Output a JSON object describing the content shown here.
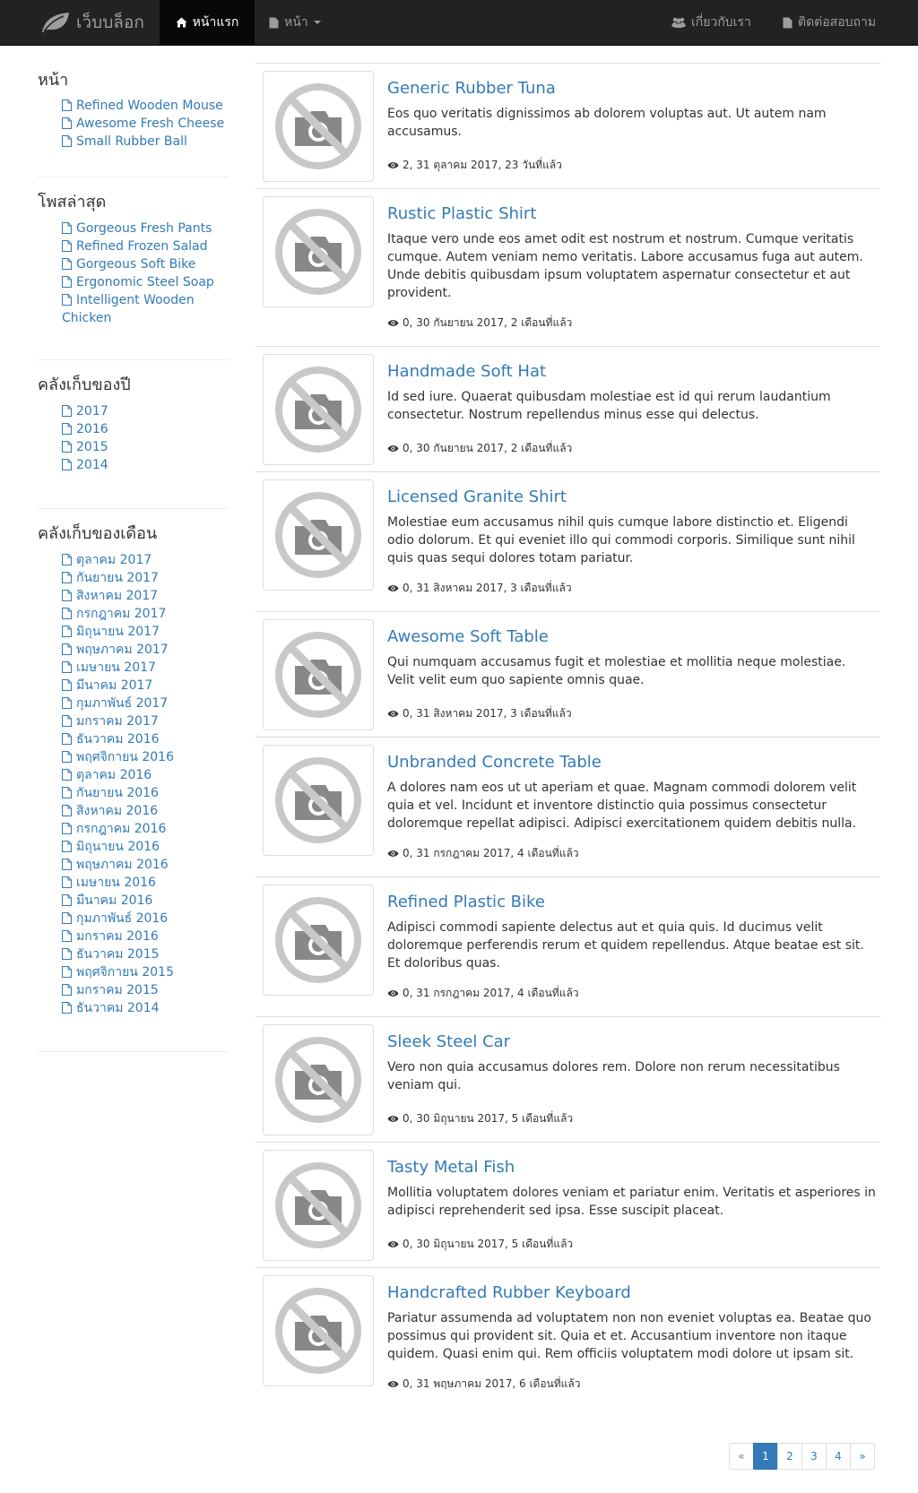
{
  "navbar": {
    "brand": "เว็บบล็อก",
    "home_label": "หน้าแรก",
    "pages_label": "หน้า",
    "about_label": "เกี่ยวกับเรา",
    "contact_label": "ติดต่อสอบถาม"
  },
  "sidebar": {
    "pages": {
      "title": "หน้า",
      "items": [
        "Refined Wooden Mouse",
        "Awesome Fresh Cheese",
        "Small Rubber Ball"
      ]
    },
    "recent": {
      "title": "โพสล่าสุด",
      "items": [
        "Gorgeous Fresh Pants",
        "Refined Frozen Salad",
        "Gorgeous Soft Bike",
        "Ergonomic Steel Soap",
        "Intelligent Wooden Chicken"
      ]
    },
    "years": {
      "title": "คลังเก็บของปี",
      "items": [
        "2017",
        "2016",
        "2015",
        "2014"
      ]
    },
    "months": {
      "title": "คลังเก็บของเดือน",
      "items": [
        "ตุลาคม 2017",
        "กันยายน 2017",
        "สิงหาคม 2017",
        "กรกฎาคม 2017",
        "มิถุนายน 2017",
        "พฤษภาคม 2017",
        "เมษายน 2017",
        "มีนาคม 2017",
        "กุมภาพันธ์ 2017",
        "มกราคม 2017",
        "ธันวาคม 2016",
        "พฤศจิกายน 2016",
        "ตุลาคม 2016",
        "กันยายน 2016",
        "สิงหาคม 2016",
        "กรกฎาคม 2016",
        "มิถุนายน 2016",
        "พฤษภาคม 2016",
        "เมษายน 2016",
        "มีนาคม 2016",
        "กุมภาพันธ์ 2016",
        "มกราคม 2016",
        "ธันวาคม 2015",
        "พฤศจิกายน 2015",
        "มกราคม 2015",
        "ธันวาคม 2014"
      ]
    }
  },
  "posts": [
    {
      "title": "Generic Rubber Tuna",
      "excerpt": "Eos quo veritatis dignissimos ab dolorem voluptas aut. Ut autem nam accusamus.",
      "meta": "2, 31 ตุลาคม 2017, 23 วันที่แล้ว"
    },
    {
      "title": "Rustic Plastic Shirt",
      "excerpt": "Itaque vero unde eos amet odit est nostrum et nostrum. Cumque veritatis cumque. Autem veniam nemo veritatis. Labore accusamus fuga aut autem. Unde debitis quibusdam ipsum voluptatem aspernatur consectetur et aut provident.",
      "meta": "0, 30 กันยายน 2017, 2 เดือนที่แล้ว"
    },
    {
      "title": "Handmade Soft Hat",
      "excerpt": "Id sed iure. Quaerat quibusdam molestiae est id qui rerum laudantium consectetur. Nostrum repellendus minus esse qui delectus.",
      "meta": "0, 30 กันยายน 2017, 2 เดือนที่แล้ว"
    },
    {
      "title": "Licensed Granite Shirt",
      "excerpt": "Molestiae eum accusamus nihil quis cumque labore distinctio et. Eligendi odio dolorum. Et qui eveniet illo qui commodi corporis. Similique sunt nihil quis quas sequi dolores totam pariatur.",
      "meta": "0, 31 สิงหาคม 2017, 3 เดือนที่แล้ว"
    },
    {
      "title": "Awesome Soft Table",
      "excerpt": "Qui numquam accusamus fugit et molestiae et mollitia neque molestiae. Velit velit eum quo sapiente omnis quae.",
      "meta": "0, 31 สิงหาคม 2017, 3 เดือนที่แล้ว"
    },
    {
      "title": "Unbranded Concrete Table",
      "excerpt": "A dolores nam eos ut ut aperiam et quae. Magnam commodi dolorem velit quia et vel. Incidunt et inventore distinctio quia possimus consectetur doloremque repellat adipisci. Adipisci exercitationem quidem debitis nulla.",
      "meta": "0, 31 กรกฎาคม 2017, 4 เดือนที่แล้ว"
    },
    {
      "title": "Refined Plastic Bike",
      "excerpt": "Adipisci commodi sapiente delectus aut et quia quis. Id ducimus velit doloremque perferendis rerum et quidem repellendus. Atque beatae est sit. Et doloribus quas.",
      "meta": "0, 31 กรกฎาคม 2017, 4 เดือนที่แล้ว"
    },
    {
      "title": "Sleek Steel Car",
      "excerpt": "Vero non quia accusamus dolores rem. Dolore non rerum necessitatibus veniam qui.",
      "meta": "0, 30 มิถุนายน 2017, 5 เดือนที่แล้ว"
    },
    {
      "title": "Tasty Metal Fish",
      "excerpt": "Mollitia voluptatem dolores veniam et pariatur enim. Veritatis et asperiores in adipisci reprehenderit sed ipsa. Esse suscipit placeat.",
      "meta": "0, 30 มิถุนายน 2017, 5 เดือนที่แล้ว"
    },
    {
      "title": "Handcrafted Rubber Keyboard",
      "excerpt": "Pariatur assumenda ad voluptatem non non eveniet voluptas ea. Beatae quo possimus qui provident sit. Quia et et. Accusantium inventore non itaque quidem. Quasi enim qui. Rem officiis voluptatem modi dolore ut ipsam sit.",
      "meta": "0, 31 พฤษภาคม 2017, 6 เดือนที่แล้ว"
    }
  ],
  "pagination": {
    "prev": "«",
    "pages": [
      "1",
      "2",
      "3",
      "4"
    ],
    "next": "»",
    "active": "1"
  }
}
